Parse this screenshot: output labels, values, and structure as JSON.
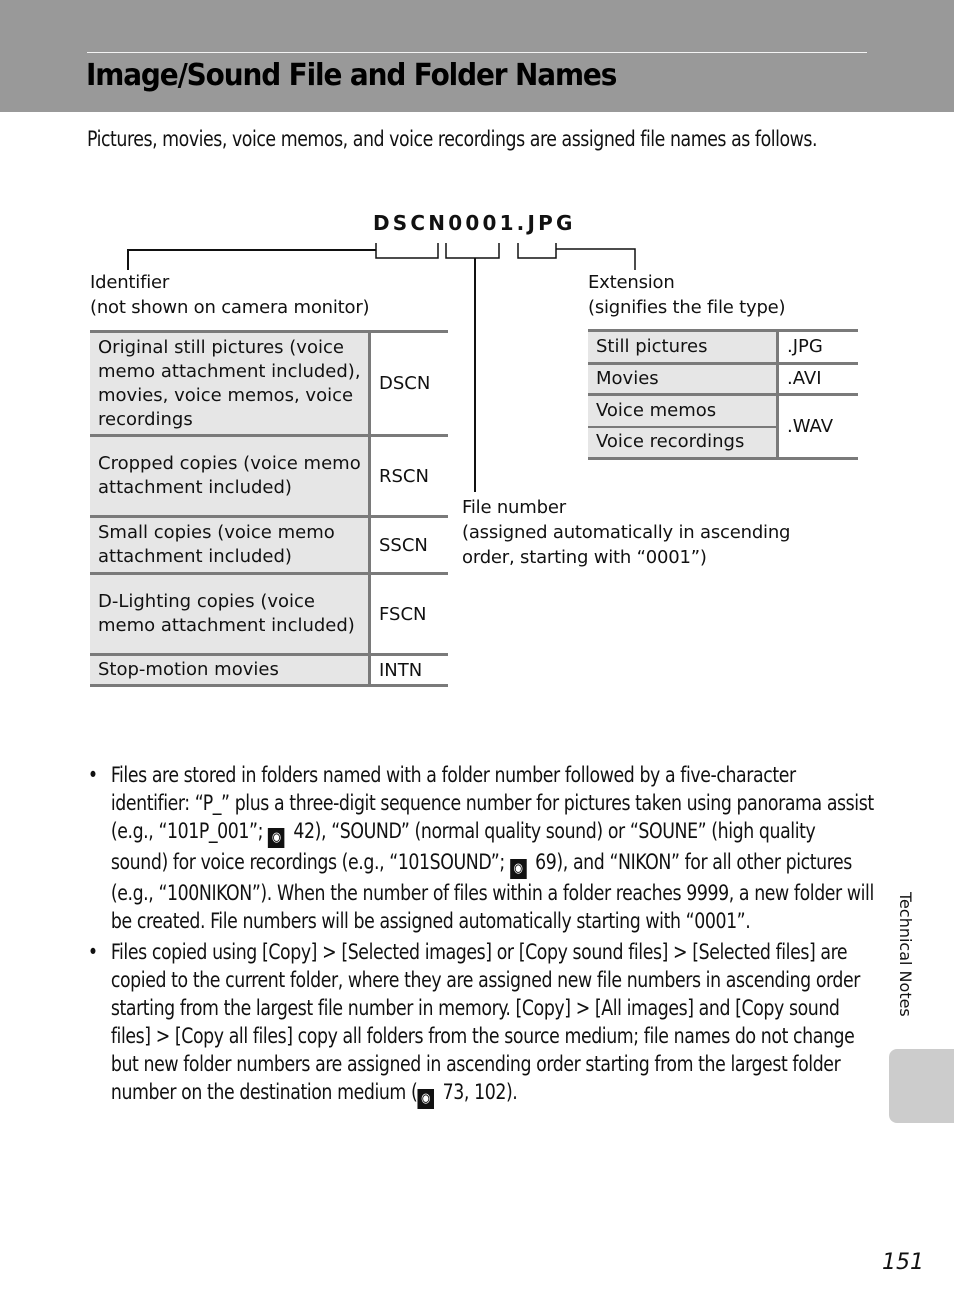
{
  "header": {
    "title": "Image/Sound File and Folder Names"
  },
  "intro": "Pictures, movies, voice memos, and voice recordings are assigned file names as follows.",
  "diagram": {
    "filename": "DSCN0001.JPG",
    "identifier": {
      "title": "Identifier",
      "subtitle": "(not shown on camera monitor)",
      "rows": [
        {
          "description": "Original still pictures (voice memo attachment included), movies, voice memos, voice recordings",
          "code": "DSCN"
        },
        {
          "description": "Cropped copies (voice memo attachment included)",
          "code": "RSCN"
        },
        {
          "description": "Small copies (voice memo attachment included)",
          "code": "SSCN"
        },
        {
          "description": "D-Lighting copies (voice memo attachment included)",
          "code": "FSCN"
        },
        {
          "description": "Stop-motion movies",
          "code": "INTN"
        }
      ]
    },
    "file_number": {
      "title": "File number",
      "subtitle_line1": "(assigned automatically in ascending",
      "subtitle_line2": "order, starting with “0001”)"
    },
    "extension": {
      "title": "Extension",
      "subtitle": "(signifies the file type)",
      "rows": [
        {
          "description": "Still pictures",
          "ext": ".JPG"
        },
        {
          "description": "Movies",
          "ext": ".AVI"
        },
        {
          "description": "Voice memos",
          "ext": ".WAV"
        },
        {
          "description": "Voice recordings",
          "ext": ".WAV"
        }
      ]
    }
  },
  "bullets": [
    {
      "parts": [
        "Files are stored in folders named with a folder number followed by a five-character identifier: “P_” plus a three-digit sequence number for pictures taken using panorama assist (e.g., “101P_001”; ",
        " 42), “SOUND” (normal quality sound) or “SOUNE” (high quality sound) for voice recordings (e.g., “101SOUND”; ",
        " 69), and “NIKON” for all other pictures (e.g., “100NIKON”). When the number of files within a folder reaches 9999, a new folder will be created. File numbers will be assigned automatically starting with “0001”."
      ]
    },
    {
      "parts": [
        "Files copied using [Copy] > [Selected images] or [Copy sound files] > [Selected files] are copied to the current folder, where they are assigned new file numbers in ascending order starting from the largest file number in memory. [Copy] > [All images] and [Copy sound files] > [Copy all files] copy all folders from the source medium; file names do not change but new folder numbers are assigned in ascending order starting from the largest folder number on the destination medium (",
        " 73, 102)."
      ]
    }
  ],
  "icons": {
    "bullet": "•",
    "page_reference": "page-reference-icon"
  },
  "sidebar": {
    "section_label": "Technical Notes"
  },
  "footer": {
    "page_number": "151"
  }
}
